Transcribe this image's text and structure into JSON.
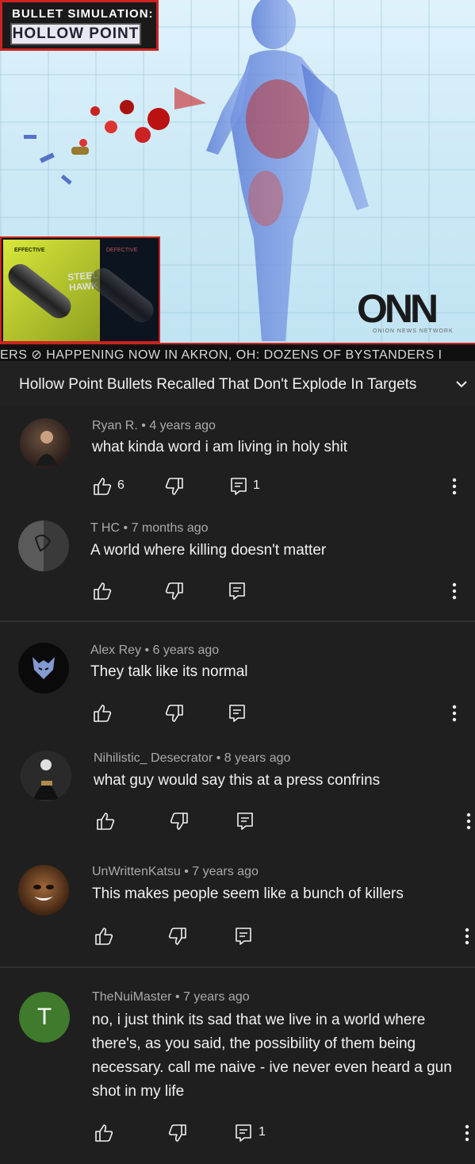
{
  "video": {
    "sim_title": "BULLET SIMULATION:",
    "sim_subtitle": "HOLLOW POINT",
    "ammo_effective": "EFFECTIVE",
    "ammo_defective": "DEFECTIVE",
    "ammo_brand": "STEEL HAWK",
    "logo": "ONN",
    "logo_sub": "ONION NEWS NETWORK",
    "ticker": "ERS   ⊘   HAPPENING NOW IN AKRON, OH: DOZENS OF BYSTANDERS I"
  },
  "title": "Hollow Point Bullets Recalled That Don't Explode In Targets",
  "comments": [
    {
      "author": "Ryan R.",
      "time": "4 years ago",
      "text": "what kinda word i am living in holy shit",
      "likes": "6",
      "replies": "1"
    },
    {
      "author": "T HC",
      "time": "7 months ago",
      "text": "A world where killing doesn't matter",
      "likes": "",
      "replies": ""
    },
    {
      "author": "Alex Rey",
      "time": "6 years ago",
      "text": "They talk like its normal",
      "likes": "",
      "replies": ""
    },
    {
      "author": "Nihilistic_ Desecrator",
      "time": "8 years ago",
      "text": "what guy would say this at a press confrins",
      "likes": "",
      "replies": ""
    },
    {
      "author": "UnWrittenKatsu",
      "time": "7 years ago",
      "text": "This makes people seem like a bunch of killers",
      "likes": "",
      "replies": ""
    },
    {
      "author": "TheNuiMaster",
      "time": "7 years ago",
      "text": "no, i just think its sad that we live in a world where there's, as you said, the possibility of them being necessary. call me naive - ive never even heard a gun shot in my life",
      "likes": "",
      "replies": "1",
      "initial": "T"
    }
  ],
  "separator": "•",
  "colors": {
    "background": "#1f1f1f",
    "text": "#f1f1f1",
    "meta": "#aaaaaa",
    "avatar_green": "#3f7a2d",
    "accent_red": "#cc2222"
  }
}
